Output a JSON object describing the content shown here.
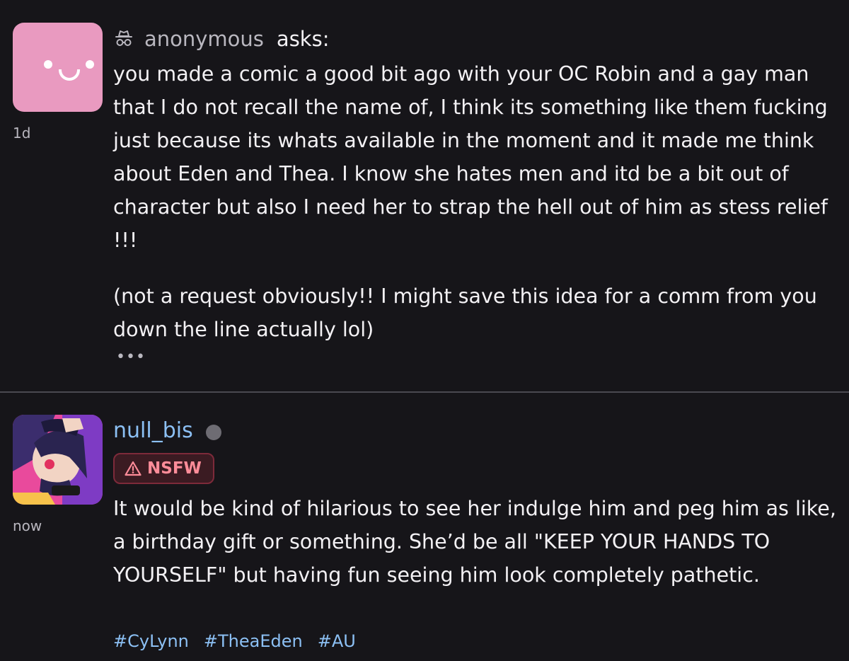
{
  "question": {
    "asker": "anonymous",
    "asks_label": "asks:",
    "avatar_icon": "anon-face-icon",
    "time": "1d",
    "paragraphs": [
      "you made a comic a good bit ago with your OC Robin and a gay man that I do not recall the name of, I think its something like them fucking just because its whats available in the moment and it made me think about Eden and Thea. I know she hates men and itd be a bit out of character but also I need her to strap the hell out of him as stess relief !!!",
      "(not a request obviously!! I might save this idea for a comm from you down the line actually lol)"
    ],
    "more": "•••"
  },
  "answer": {
    "username": "null_bis",
    "time": "now",
    "badge": "NSFW",
    "text": "It would be kind of hilarious to see her indulge him and peg him as like, a birthday gift or something. She’d be all \"KEEP YOUR HANDS TO YOURSELF\" but having fun seeing him look completely pathetic.",
    "tags": [
      "#CyLynn",
      "#TheaEden",
      "#AU"
    ]
  },
  "colors": {
    "background": "#161519",
    "text": "#f3f1f4",
    "muted": "#b9b7bf",
    "link": "#8cc0f4",
    "anon_avatar": "#e99ac0",
    "nsfw_text": "#ff8c99",
    "nsfw_bg": "#3b1b22"
  }
}
